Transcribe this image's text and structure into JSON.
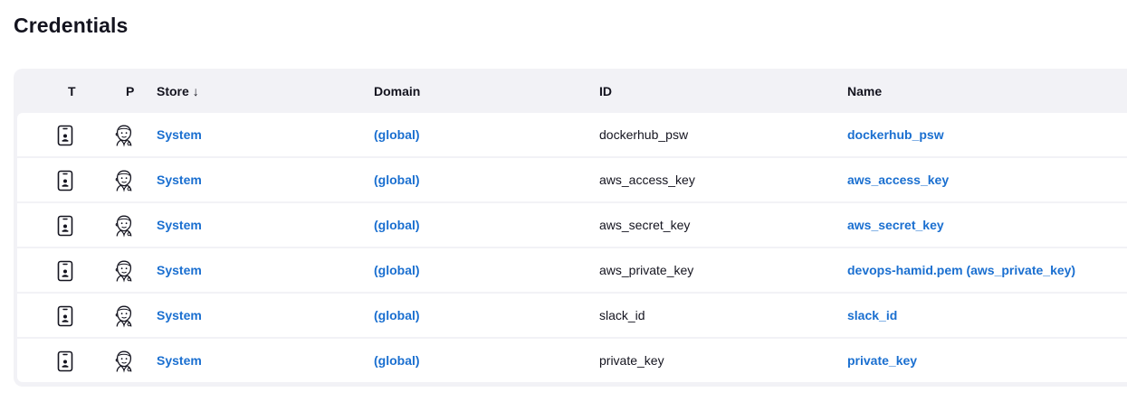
{
  "page": {
    "title": "Credentials"
  },
  "table": {
    "headers": {
      "type": "T",
      "provider": "P",
      "store": "Store",
      "store_sort_indicator": "↓",
      "domain": "Domain",
      "id": "ID",
      "name": "Name"
    },
    "rows": [
      {
        "type_icon": "mobile-credential-icon",
        "provider_icon": "jenkins-icon",
        "store": "System",
        "domain": "(global)",
        "id": "dockerhub_psw",
        "name": "dockerhub_psw"
      },
      {
        "type_icon": "mobile-credential-icon",
        "provider_icon": "jenkins-icon",
        "store": "System",
        "domain": "(global)",
        "id": "aws_access_key",
        "name": "aws_access_key"
      },
      {
        "type_icon": "mobile-credential-icon",
        "provider_icon": "jenkins-icon",
        "store": "System",
        "domain": "(global)",
        "id": "aws_secret_key",
        "name": "aws_secret_key"
      },
      {
        "type_icon": "mobile-credential-icon",
        "provider_icon": "jenkins-icon",
        "store": "System",
        "domain": "(global)",
        "id": "aws_private_key",
        "name": "devops-hamid.pem (aws_private_key)"
      },
      {
        "type_icon": "mobile-credential-icon",
        "provider_icon": "jenkins-icon",
        "store": "System",
        "domain": "(global)",
        "id": "slack_id",
        "name": "slack_id"
      },
      {
        "type_icon": "mobile-credential-icon",
        "provider_icon": "jenkins-icon",
        "store": "System",
        "domain": "(global)",
        "id": "private_key",
        "name": "private_key"
      }
    ]
  },
  "colors": {
    "link": "#1a6fd0",
    "header_bg": "#f2f2f6",
    "text": "#14141f"
  }
}
